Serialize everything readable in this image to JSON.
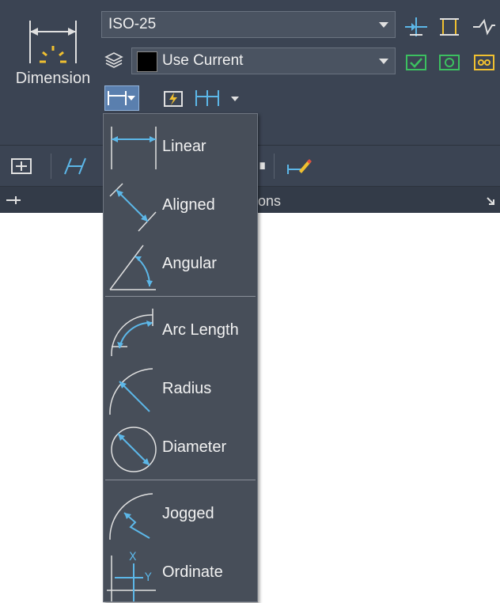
{
  "dimension_button": {
    "label": "Dimension"
  },
  "dimstyle_combo": {
    "value": "ISO-25"
  },
  "layer_combo": {
    "value": "Use Current",
    "swatch_color": "#000000"
  },
  "panel_title_partial": "ons",
  "dropdown_menu": {
    "items": [
      {
        "label": "Linear",
        "icon": "linear-dim-icon"
      },
      {
        "label": "Aligned",
        "icon": "aligned-dim-icon"
      },
      {
        "label": "Angular",
        "icon": "angular-dim-icon"
      },
      {
        "label": "Arc Length",
        "icon": "arc-length-dim-icon"
      },
      {
        "label": "Radius",
        "icon": "radius-dim-icon"
      },
      {
        "label": "Diameter",
        "icon": "diameter-dim-icon"
      },
      {
        "label": "Jogged",
        "icon": "jogged-dim-icon"
      },
      {
        "label": "Ordinate",
        "icon": "ordinate-dim-icon"
      }
    ]
  },
  "colors": {
    "ribbon_bg": "#3b4453",
    "menu_bg": "#474e59",
    "icon_blue": "#5cb7e8",
    "accent_yellow": "#f0c030",
    "accent_green": "#3cc060"
  }
}
